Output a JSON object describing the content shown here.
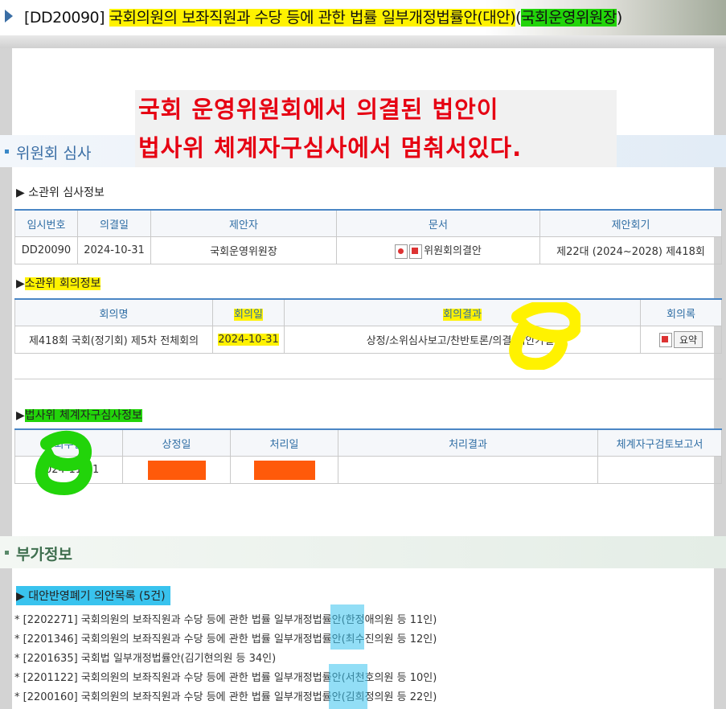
{
  "header": {
    "bill_no": "[DD20090]",
    "title": "국회의원의 보좌직원과 수당 등에 관한 법률 일부개정법률안(대안)",
    "proposer_open": "(",
    "proposer": "국회운영위원장",
    "proposer_close": ")"
  },
  "annotation": {
    "line1": "국회 운영위원회에서 의결된 법안이",
    "line2": "법사위 체계자구심사에서 멈춰서있다."
  },
  "committee_review": {
    "section_title": "위원회 심사",
    "review_info": {
      "label": "▶ 소관위 심사정보",
      "headers": [
        "임시번호",
        "의결일",
        "제안자",
        "문서",
        "제안회기"
      ],
      "row": {
        "temp_no": "DD20090",
        "decision_date": "2024-10-31",
        "proposer": "국회운영위원장",
        "document": "위원회의결안",
        "session": "제22대 (2024~2028) 제418회"
      }
    },
    "meeting_info": {
      "label_arrow": "▶",
      "label": "소관위 회의정보",
      "headers": [
        "회의명",
        "회의일",
        "회의결과",
        "회의록"
      ],
      "row": {
        "meeting_name": "제418회 국회(정기회) 제5차 전체회의",
        "meeting_date": "2024-10-31",
        "result": "상정/소위심사보고/찬반토론/의결(대안가결)",
        "summary_button": "요약"
      }
    },
    "legislation_review": {
      "label_arrow": "▶",
      "label": "법사위 체계자구심사정보",
      "headers": [
        "회부일",
        "상정일",
        "처리일",
        "처리결과",
        "체계자구검토보고서"
      ],
      "row": {
        "referral_date": "2024-11-01",
        "submission_date": "",
        "processing_date": "",
        "result": "",
        "report": ""
      }
    }
  },
  "additional_info": {
    "section_title": "부가정보",
    "list_label": "▶ 대안반영폐기 의안목록 (5건)",
    "items": [
      "* [2202271] 국회의원의 보좌직원과 수당 등에 관한 법률 일부개정법률안(한정애의원 등 11인)",
      "* [2201346] 국회의원의 보좌직원과 수당 등에 관한 법률 일부개정법률안(최수진의원 등 12인)",
      "* [2201635] 국회법 일부개정법률안(김기현의원 등 34인)",
      "* [2201122] 국회의원의 보좌직원과 수당 등에 관한 법률 일부개정법률안(서천호의원 등 10인)",
      "* [2200160] 국회의원의 보좌직원과 수당 등에 관한 법률 일부개정법률안(김희정의원 등 22인)"
    ]
  },
  "colors": {
    "highlight_yellow": "#fff200",
    "highlight_green": "#22d40a",
    "highlight_blue": "#39c3ee",
    "redaction_orange": "#ff5a0a",
    "annotation_red": "#e60012",
    "accent_blue": "#3a6ea5"
  }
}
